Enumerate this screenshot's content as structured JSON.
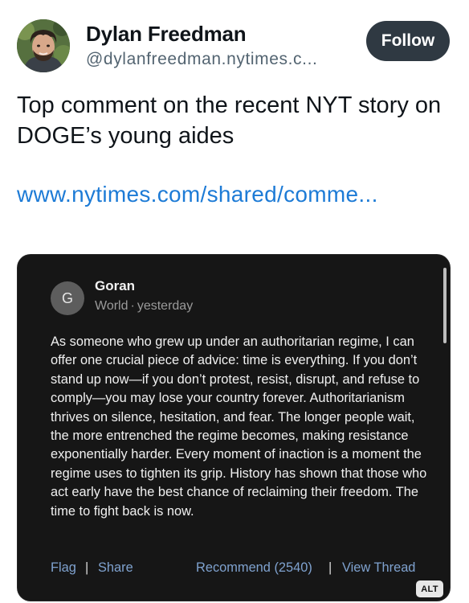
{
  "post": {
    "author_name": "Dylan Freedman",
    "author_handle": "@dylanfreedman.nytimes.c...",
    "follow_label": "Follow",
    "text": "Top comment on the recent NYT story on DOGE’s young aides",
    "link_text": "www.nytimes.com/shared/comme..."
  },
  "comment_card": {
    "avatar_letter": "G",
    "commenter": "Goran",
    "location": "World",
    "separator": "·",
    "time": "yesterday",
    "body": "As someone who grew up under an authoritarian regime, I can offer one crucial piece of advice: time is everything. If you don’t stand up now—if you don’t protest, resist, disrupt, and refuse to comply—you may lose your country forever. Authoritarianism thrives on silence, hesitation, and fear. The longer people wait, the more entrenched the regime becomes, making resistance exponentially harder. Every moment of inaction is a moment the regime uses to tighten its grip. History has shown that those who act early have the best chance of reclaiming their freedom. The time to fight back is now.",
    "actions": {
      "flag": "Flag",
      "divider": "|",
      "share": "Share",
      "recommend": "Recommend (2540)",
      "view_thread": "View Thread"
    }
  },
  "alt_badge": "ALT",
  "colors": {
    "link": "#1d7bd6",
    "follow_bg": "#2f3942",
    "card_bg": "#161616",
    "card_link": "#7fa2cf"
  }
}
